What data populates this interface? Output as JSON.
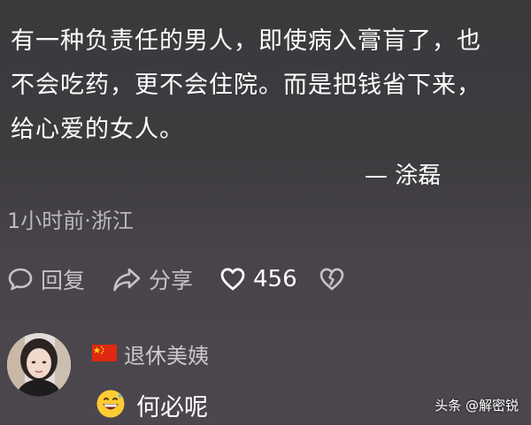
{
  "post": {
    "lines": [
      "有一种负责任的男人，即使病入膏肓了，也",
      "不会吃药，更不会住院。而是把钱省下来，",
      "给心爱的女人。"
    ],
    "author": "— 涂磊",
    "meta": "1小时前·浙江"
  },
  "actions": {
    "reply_label": "回复",
    "share_label": "分享",
    "like_count": "456",
    "icons": [
      "reply-icon",
      "share-icon",
      "heart-icon",
      "broken-heart-icon"
    ]
  },
  "comment": {
    "username": "退休美姨",
    "flag": "china-flag",
    "emoji": "grinning-sweat-emoji",
    "text": "何必呢"
  },
  "watermark": {
    "text": "头条 @解密锐"
  },
  "colors": {
    "background": "#3d3b3e",
    "text": "#ffffff",
    "secondary_text": "#b9b8bc",
    "flag_red": "#de2910",
    "flag_star": "#ffde00"
  }
}
